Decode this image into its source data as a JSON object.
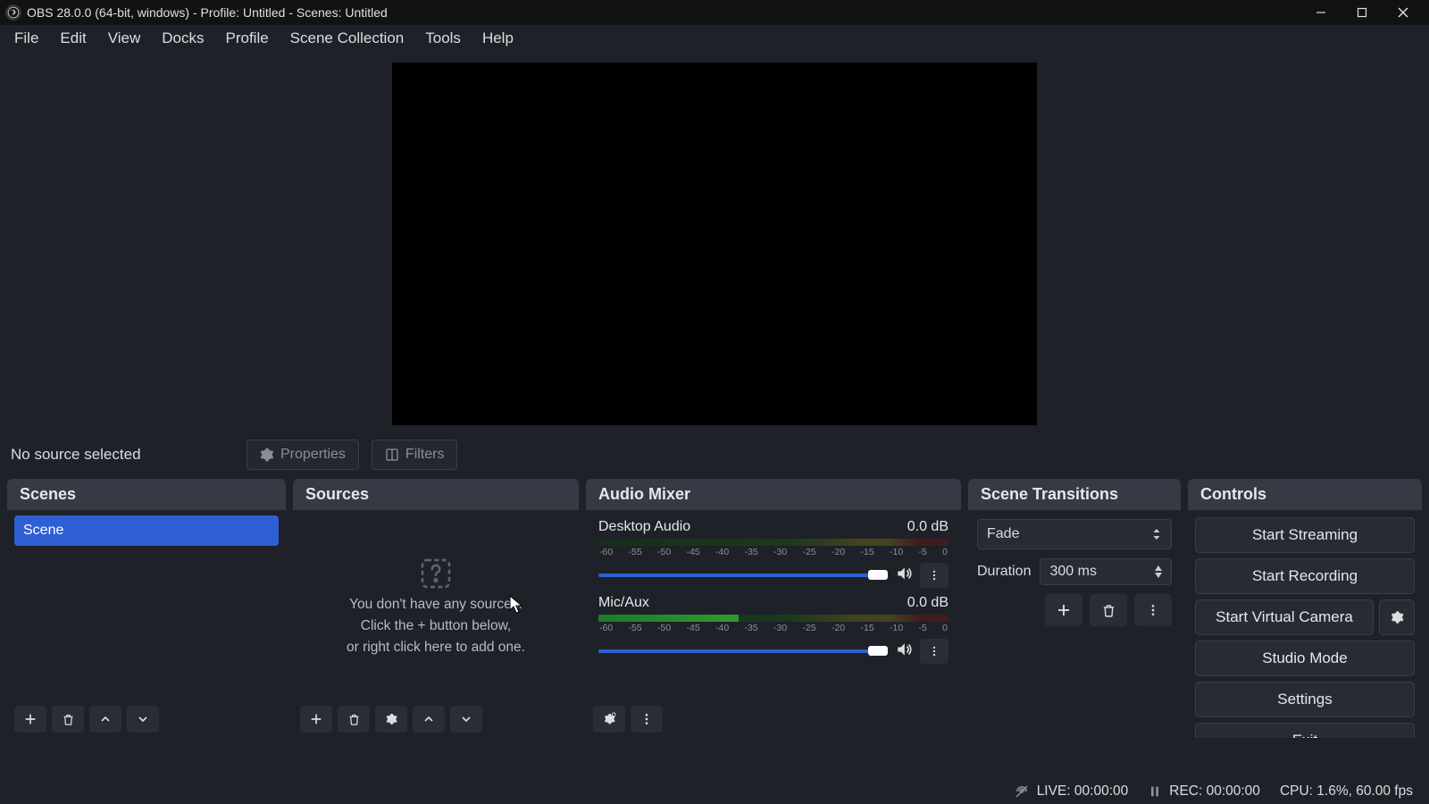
{
  "title": "OBS 28.0.0 (64-bit, windows) - Profile: Untitled - Scenes: Untitled",
  "menu": [
    "File",
    "Edit",
    "View",
    "Docks",
    "Profile",
    "Scene Collection",
    "Tools",
    "Help"
  ],
  "source_status": "No source selected",
  "toolbar": {
    "properties": "Properties",
    "filters": "Filters"
  },
  "panels": {
    "scenes": {
      "title": "Scenes",
      "items": [
        "Scene"
      ]
    },
    "sources": {
      "title": "Sources",
      "empty1": "You don't have any sources.",
      "empty2": "Click the + button below,",
      "empty3": "or right click here to add one."
    },
    "mixer": {
      "title": "Audio Mixer",
      "ticks": [
        "-60",
        "-55",
        "-50",
        "-45",
        "-40",
        "-35",
        "-30",
        "-25",
        "-20",
        "-15",
        "-10",
        "-5",
        "0"
      ],
      "tracks": [
        {
          "name": "Desktop Audio",
          "db": "0.0 dB",
          "levelMask": "100%"
        },
        {
          "name": "Mic/Aux",
          "db": "0.0 dB",
          "levelMask": "60%"
        }
      ]
    },
    "transitions": {
      "title": "Scene Transitions",
      "selected": "Fade",
      "duration_label": "Duration",
      "duration_value": "300 ms"
    },
    "controls": {
      "title": "Controls",
      "start_streaming": "Start Streaming",
      "start_recording": "Start Recording",
      "start_virtual": "Start Virtual Camera",
      "studio_mode": "Studio Mode",
      "settings": "Settings",
      "exit": "Exit"
    }
  },
  "status": {
    "live": "LIVE: 00:00:00",
    "rec": "REC: 00:00:00",
    "cpu": "CPU: 1.6%, 60.00 fps"
  }
}
